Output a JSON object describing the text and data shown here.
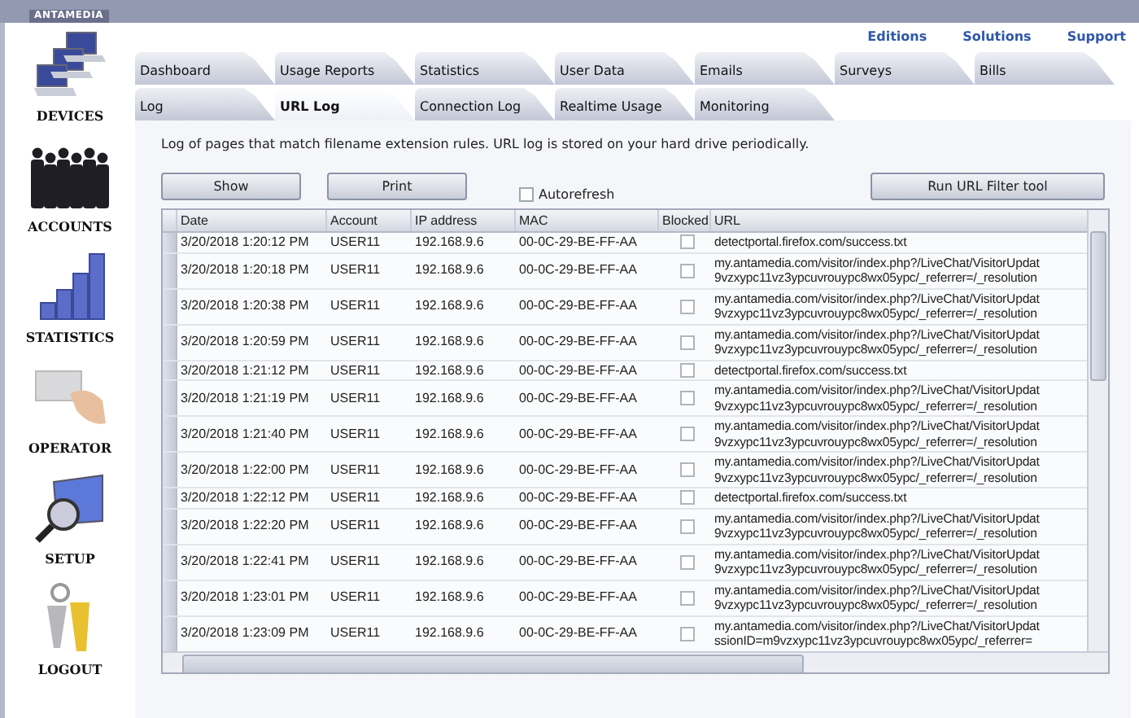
{
  "logo": {
    "text": "ANTAMEDIA"
  },
  "top_links": [
    "Editions",
    "Solutions",
    "Support"
  ],
  "sidebar": {
    "items": [
      {
        "label": "DEVICES",
        "kind": "devices"
      },
      {
        "label": "ACCOUNTS",
        "kind": "accounts"
      },
      {
        "label": "STATISTICS",
        "kind": "statistics"
      },
      {
        "label": "OPERATOR",
        "kind": "operator"
      },
      {
        "label": "SETUP",
        "kind": "setup"
      },
      {
        "label": "LOGOUT",
        "kind": "logout"
      }
    ]
  },
  "tabs": {
    "rows": [
      [
        {
          "label": "Dashboard",
          "selected": false
        },
        {
          "label": "Usage Reports",
          "selected": false
        },
        {
          "label": "Statistics",
          "selected": false
        },
        {
          "label": "User Data",
          "selected": false
        },
        {
          "label": "Emails",
          "selected": false
        },
        {
          "label": "Surveys",
          "selected": false
        },
        {
          "label": "Bills",
          "selected": false
        }
      ],
      [
        {
          "label": "Log",
          "selected": false
        },
        {
          "label": "URL Log",
          "selected": true
        },
        {
          "label": "Connection Log",
          "selected": false
        },
        {
          "label": "Realtime Usage",
          "selected": false
        },
        {
          "label": "Monitoring",
          "selected": false
        }
      ]
    ]
  },
  "description": "Log of pages that match filename extension rules. URL log is stored on your hard drive periodically.",
  "toolbar": {
    "buttons": [
      "Show",
      "Print"
    ],
    "autorefresh": {
      "label": "Autorefresh",
      "checked": false
    },
    "run_button": "Run URL Filter tool"
  },
  "table": {
    "columns": [
      "Date",
      "Account",
      "IP address",
      "MAC",
      "Blocked",
      "URL"
    ],
    "rows": [
      {
        "date": "3/20/2018 1:20:12 PM",
        "account": "USER11",
        "ip": "192.168.9.6",
        "mac": "00-0C-29-BE-FF-AA",
        "blocked": false,
        "url": [
          "detectportal.firefox.com/success.txt"
        ]
      },
      {
        "date": "3/20/2018 1:20:18 PM",
        "account": "USER11",
        "ip": "192.168.9.6",
        "mac": "00-0C-29-BE-FF-AA",
        "blocked": false,
        "url": [
          "my.antamedia.com/visitor/index.php?/LiveChat/VisitorUpdat",
          "9vzxypc11vz3ypcuvrouypc8wx05ypc/_referrer=/_resolution"
        ]
      },
      {
        "date": "3/20/2018 1:20:38 PM",
        "account": "USER11",
        "ip": "192.168.9.6",
        "mac": "00-0C-29-BE-FF-AA",
        "blocked": false,
        "url": [
          "my.antamedia.com/visitor/index.php?/LiveChat/VisitorUpdat",
          "9vzxypc11vz3ypcuvrouypc8wx05ypc/_referrer=/_resolution"
        ]
      },
      {
        "date": "3/20/2018 1:20:59 PM",
        "account": "USER11",
        "ip": "192.168.9.6",
        "mac": "00-0C-29-BE-FF-AA",
        "blocked": false,
        "url": [
          "my.antamedia.com/visitor/index.php?/LiveChat/VisitorUpdat",
          "9vzxypc11vz3ypcuvrouypc8wx05ypc/_referrer=/_resolution"
        ]
      },
      {
        "date": "3/20/2018 1:21:12 PM",
        "account": "USER11",
        "ip": "192.168.9.6",
        "mac": "00-0C-29-BE-FF-AA",
        "blocked": false,
        "url": [
          "detectportal.firefox.com/success.txt"
        ]
      },
      {
        "date": "3/20/2018 1:21:19 PM",
        "account": "USER11",
        "ip": "192.168.9.6",
        "mac": "00-0C-29-BE-FF-AA",
        "blocked": false,
        "url": [
          "my.antamedia.com/visitor/index.php?/LiveChat/VisitorUpdat",
          "9vzxypc11vz3ypcuvrouypc8wx05ypc/_referrer=/_resolution"
        ]
      },
      {
        "date": "3/20/2018 1:21:40 PM",
        "account": "USER11",
        "ip": "192.168.9.6",
        "mac": "00-0C-29-BE-FF-AA",
        "blocked": false,
        "url": [
          "my.antamedia.com/visitor/index.php?/LiveChat/VisitorUpdat",
          "9vzxypc11vz3ypcuvrouypc8wx05ypc/_referrer=/_resolution"
        ]
      },
      {
        "date": "3/20/2018 1:22:00 PM",
        "account": "USER11",
        "ip": "192.168.9.6",
        "mac": "00-0C-29-BE-FF-AA",
        "blocked": false,
        "url": [
          "my.antamedia.com/visitor/index.php?/LiveChat/VisitorUpdat",
          "9vzxypc11vz3ypcuvrouypc8wx05ypc/_referrer=/_resolution"
        ]
      },
      {
        "date": "3/20/2018 1:22:12 PM",
        "account": "USER11",
        "ip": "192.168.9.6",
        "mac": "00-0C-29-BE-FF-AA",
        "blocked": false,
        "url": [
          "detectportal.firefox.com/success.txt"
        ]
      },
      {
        "date": "3/20/2018 1:22:20 PM",
        "account": "USER11",
        "ip": "192.168.9.6",
        "mac": "00-0C-29-BE-FF-AA",
        "blocked": false,
        "url": [
          "my.antamedia.com/visitor/index.php?/LiveChat/VisitorUpdat",
          "9vzxypc11vz3ypcuvrouypc8wx05ypc/_referrer=/_resolution"
        ]
      },
      {
        "date": "3/20/2018 1:22:41 PM",
        "account": "USER11",
        "ip": "192.168.9.6",
        "mac": "00-0C-29-BE-FF-AA",
        "blocked": false,
        "url": [
          "my.antamedia.com/visitor/index.php?/LiveChat/VisitorUpdat",
          "9vzxypc11vz3ypcuvrouypc8wx05ypc/_referrer=/_resolution"
        ]
      },
      {
        "date": "3/20/2018 1:23:01 PM",
        "account": "USER11",
        "ip": "192.168.9.6",
        "mac": "00-0C-29-BE-FF-AA",
        "blocked": false,
        "url": [
          "my.antamedia.com/visitor/index.php?/LiveChat/VisitorUpdat",
          "9vzxypc11vz3ypcuvrouypc8wx05ypc/_referrer=/_resolution"
        ]
      },
      {
        "date": "3/20/2018 1:23:09 PM",
        "account": "USER11",
        "ip": "192.168.9.6",
        "mac": "00-0C-29-BE-FF-AA",
        "blocked": false,
        "url": [
          "my.antamedia.com/visitor/index.php?/LiveChat/VisitorUpdat",
          "ssionID=m9vzxypc11vz3ypcuvrouypc8wx05ypc/_referrer="
        ]
      }
    ]
  }
}
